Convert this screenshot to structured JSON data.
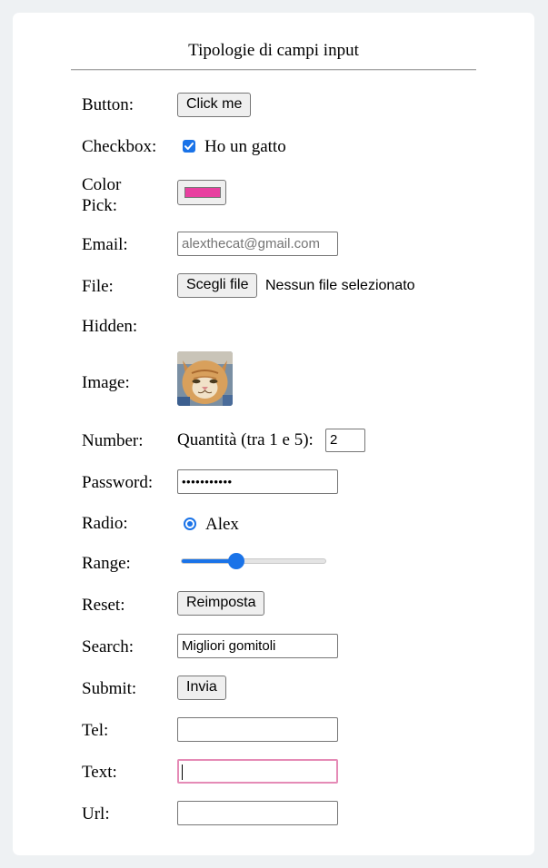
{
  "form": {
    "title": "Tipologie di campi input",
    "button": {
      "label": "Button:",
      "value": "Click me"
    },
    "checkbox": {
      "label": "Checkbox:",
      "text": "Ho un gatto",
      "checked": true
    },
    "color": {
      "label_line1": "Color",
      "label_line2": "Pick:",
      "value": "#e83fa0"
    },
    "email": {
      "label": "Email:",
      "placeholder": "alexthecat@gmail.com"
    },
    "file": {
      "label": "File:",
      "button": "Scegli file",
      "status": "Nessun file selezionato"
    },
    "hidden": {
      "label": "Hidden:"
    },
    "image": {
      "label": "Image:",
      "icon": "cat-photo"
    },
    "number": {
      "label": "Number:",
      "prefix": "Quantità (tra 1 e 5):",
      "value": "2"
    },
    "password": {
      "label": "Password:",
      "value": "•••••••••••"
    },
    "radio": {
      "label": "Radio:",
      "text": "Alex",
      "checked": true
    },
    "range": {
      "label": "Range:",
      "fraction": 0.38
    },
    "reset": {
      "label": "Reset:",
      "value": "Reimposta"
    },
    "search": {
      "label": "Search:",
      "value": "Migliori gomitoli"
    },
    "submit": {
      "label": "Submit:",
      "value": "Invia"
    },
    "tel": {
      "label": "Tel:",
      "value": ""
    },
    "text": {
      "label": "Text:",
      "value": ""
    },
    "url": {
      "label": "Url:",
      "value": ""
    }
  },
  "colors": {
    "accent": "#1a73e8",
    "focus_ring": "#e58bb6",
    "page_background": "#eef1f3"
  }
}
